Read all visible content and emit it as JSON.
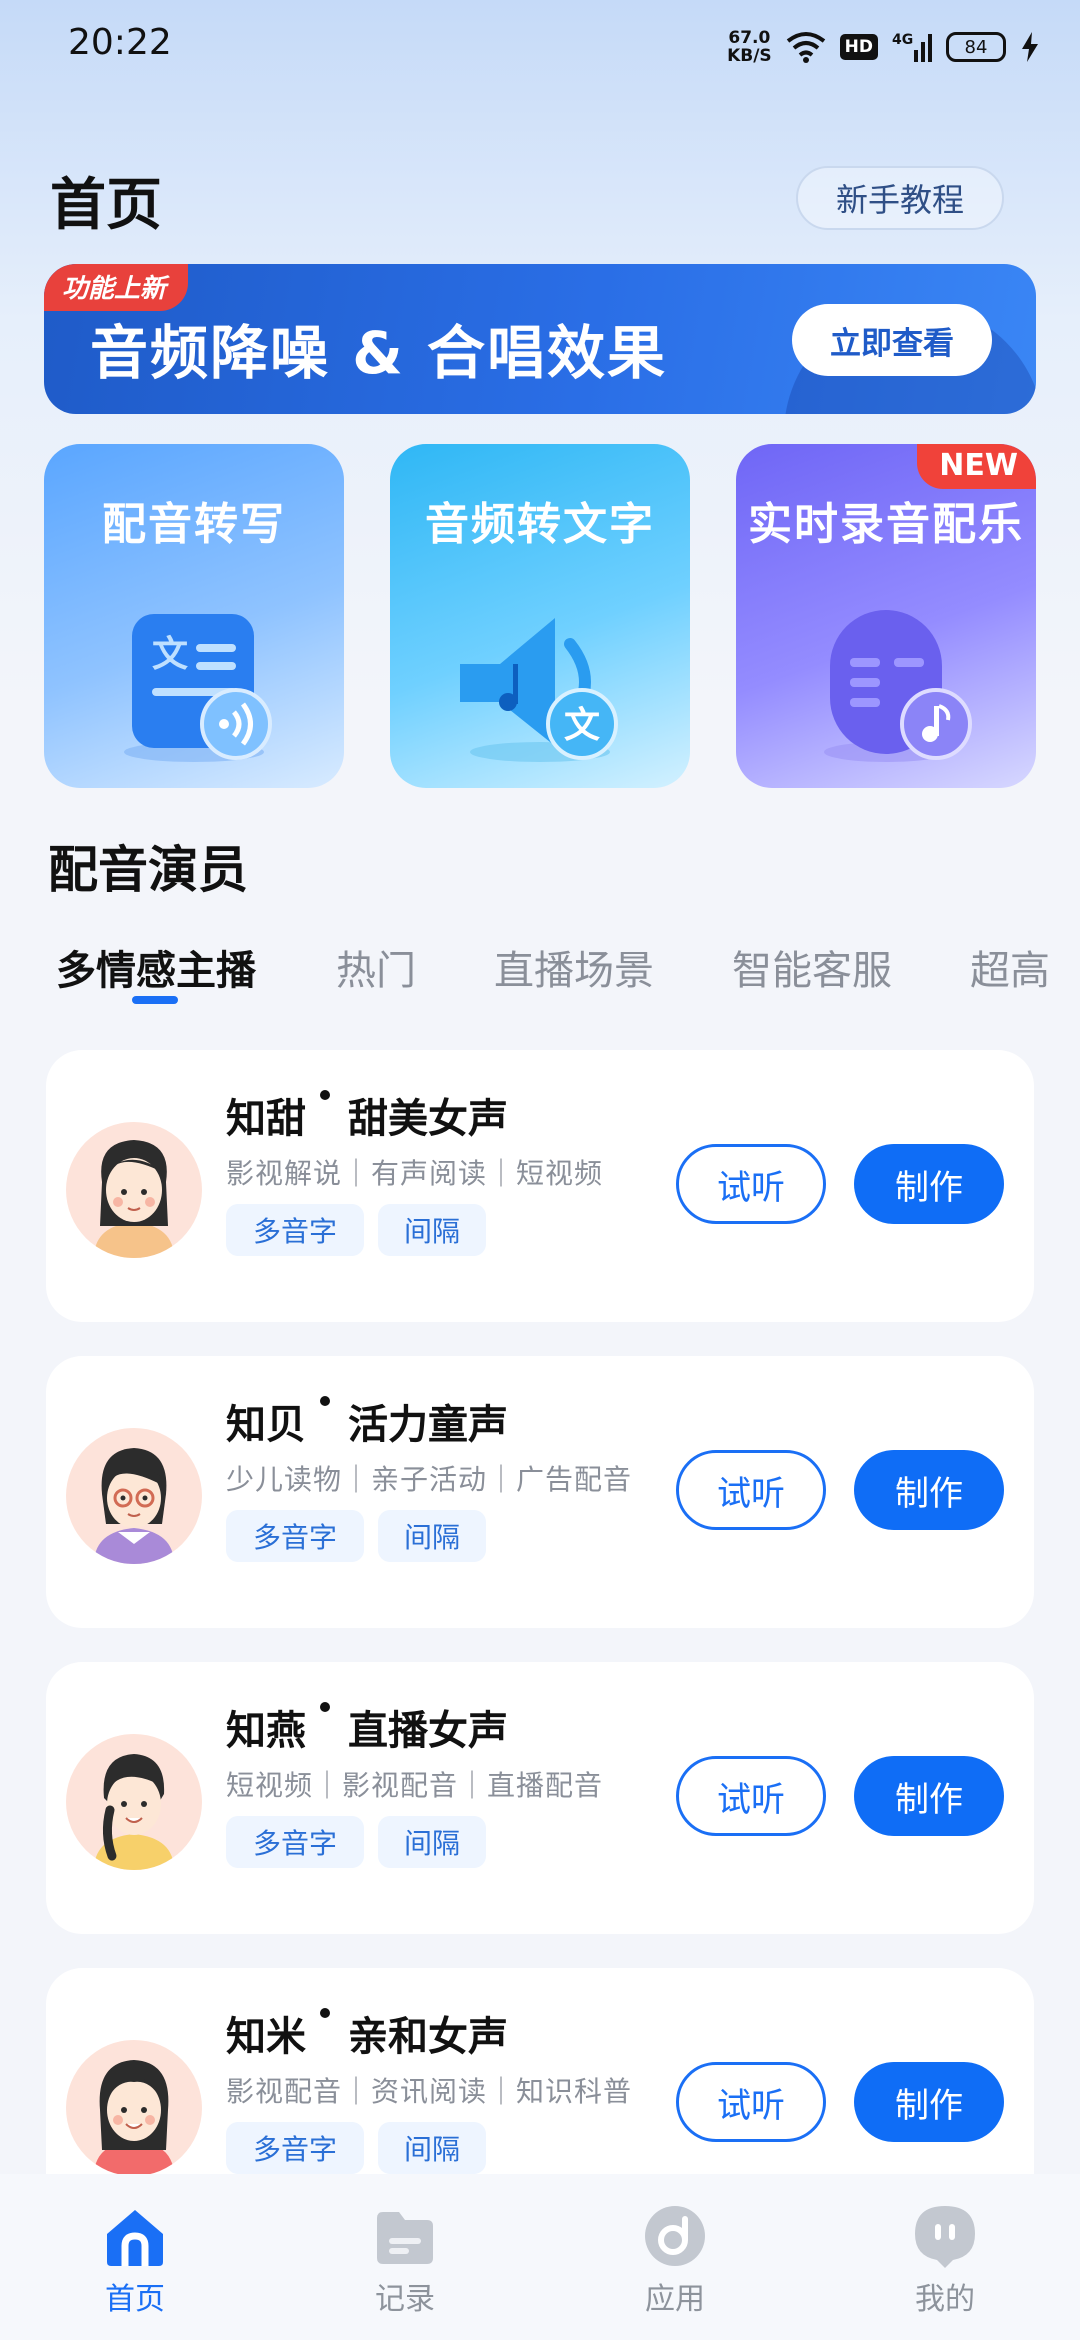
{
  "status_bar": {
    "time": "20:22",
    "net_speed_value": "67.0",
    "net_speed_unit": "KB/S",
    "hd": "HD",
    "network": "4G",
    "battery": "84",
    "icons": [
      "wifi-icon",
      "signal-icon",
      "battery-icon",
      "charging-icon"
    ]
  },
  "header": {
    "title": "首页",
    "tutorial_label": "新手教程"
  },
  "banner": {
    "badge": "功能上新",
    "title": "音频降噪 & 合唱效果",
    "button": "立即查看"
  },
  "features": [
    {
      "title": "配音转写",
      "icon": "document-audio-icon"
    },
    {
      "title": "音频转文字",
      "icon": "speaker-text-icon"
    },
    {
      "title": "实时录音配乐",
      "icon": "microphone-music-icon",
      "badge": "NEW"
    }
  ],
  "section": {
    "title": "配音演员"
  },
  "tabs": [
    "多情感主播",
    "热门",
    "直播场景",
    "智能客服",
    "超高"
  ],
  "active_tab": 0,
  "voices": [
    {
      "name": "知甜",
      "style": "甜美女声",
      "tags": "影视解说｜有声阅读｜短视频",
      "chip1": "多音字",
      "chip2": "间隔",
      "listen": "试听",
      "make": "制作"
    },
    {
      "name": "知贝",
      "style": "活力童声",
      "tags": "少儿读物｜亲子活动｜广告配音",
      "chip1": "多音字",
      "chip2": "间隔",
      "listen": "试听",
      "make": "制作"
    },
    {
      "name": "知燕",
      "style": "直播女声",
      "tags": "短视频｜影视配音｜直播配音",
      "chip1": "多音字",
      "chip2": "间隔",
      "listen": "试听",
      "make": "制作"
    },
    {
      "name": "知米",
      "style": "亲和女声",
      "tags": "影视配音｜资讯阅读｜知识科普",
      "chip1": "多音字",
      "chip2": "间隔",
      "listen": "试听",
      "make": "制作"
    }
  ],
  "bottom_nav": [
    {
      "label": "首页",
      "icon": "home-icon",
      "active": true
    },
    {
      "label": "记录",
      "icon": "folder-icon",
      "active": false
    },
    {
      "label": "应用",
      "icon": "apps-icon",
      "active": false
    },
    {
      "label": "我的",
      "icon": "profile-icon",
      "active": false
    }
  ],
  "colors": {
    "accent": "#0f6df6",
    "banner": "#2a6ee6",
    "badge_red": "#e8413c"
  }
}
